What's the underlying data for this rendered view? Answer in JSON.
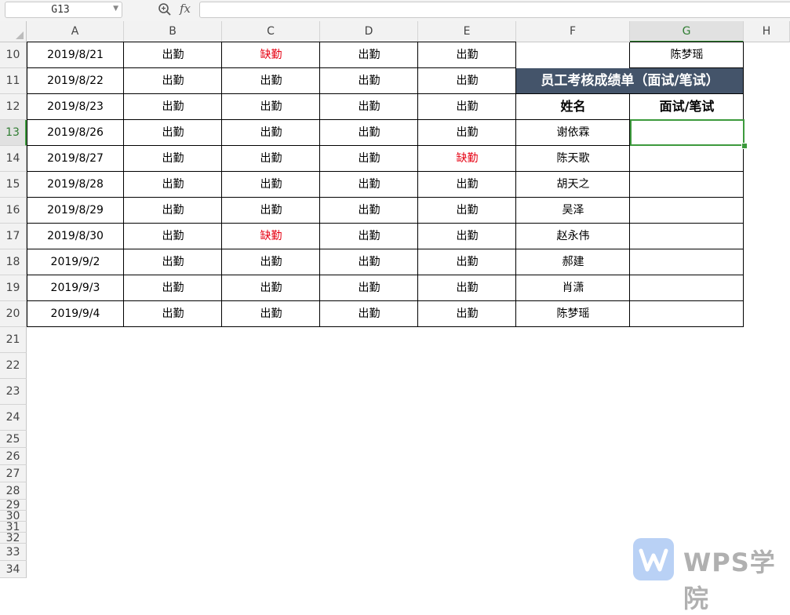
{
  "formula_bar": {
    "name_box": "G13",
    "fx_label": "fx",
    "formula": ""
  },
  "columns": [
    "A",
    "B",
    "C",
    "D",
    "E",
    "F",
    "G",
    "H"
  ],
  "rows": [
    {
      "num": "10",
      "cells": [
        "2019/8/21",
        "出勤",
        "缺勤",
        "出勤",
        "出勤",
        "",
        "陈梦瑶"
      ],
      "red": [
        2
      ]
    },
    {
      "num": "11",
      "cells": [
        "2019/8/22",
        "出勤",
        "出勤",
        "出勤",
        "出勤"
      ],
      "red": []
    },
    {
      "num": "12",
      "cells": [
        "2019/8/23",
        "出勤",
        "出勤",
        "出勤",
        "出勤",
        "姓名",
        "面试/笔试"
      ],
      "red": []
    },
    {
      "num": "13",
      "cells": [
        "2019/8/26",
        "出勤",
        "出勤",
        "出勤",
        "出勤",
        "谢依霖",
        ""
      ],
      "red": []
    },
    {
      "num": "14",
      "cells": [
        "2019/8/27",
        "出勤",
        "出勤",
        "出勤",
        "缺勤",
        "陈天歌",
        ""
      ],
      "red": [
        4
      ]
    },
    {
      "num": "15",
      "cells": [
        "2019/8/28",
        "出勤",
        "出勤",
        "出勤",
        "出勤",
        "胡天之",
        ""
      ],
      "red": []
    },
    {
      "num": "16",
      "cells": [
        "2019/8/29",
        "出勤",
        "出勤",
        "出勤",
        "出勤",
        "吴泽",
        ""
      ],
      "red": []
    },
    {
      "num": "17",
      "cells": [
        "2019/8/30",
        "出勤",
        "缺勤",
        "出勤",
        "出勤",
        "赵永伟",
        ""
      ],
      "red": [
        2
      ]
    },
    {
      "num": "18",
      "cells": [
        "2019/9/2",
        "出勤",
        "出勤",
        "出勤",
        "出勤",
        "郝建",
        ""
      ],
      "red": []
    },
    {
      "num": "19",
      "cells": [
        "2019/9/3",
        "出勤",
        "出勤",
        "出勤",
        "出勤",
        "肖潇",
        ""
      ],
      "red": []
    },
    {
      "num": "20",
      "cells": [
        "2019/9/4",
        "出勤",
        "出勤",
        "出勤",
        "出勤",
        "陈梦瑶",
        ""
      ],
      "red": []
    }
  ],
  "extra_rows": [
    "21",
    "22",
    "23",
    "24",
    "25",
    "26",
    "27",
    "28",
    "29",
    "30",
    "31",
    "32",
    "33",
    "34"
  ],
  "merged_title": "员工考核成绩单（面试/笔试）",
  "selected_cell": "G13",
  "active_column": "G",
  "active_row": "13",
  "watermark": "WPS学院",
  "colors": {
    "title_bg": "#44546a",
    "absent": "#e60012",
    "selection": "#3d9a3d"
  }
}
